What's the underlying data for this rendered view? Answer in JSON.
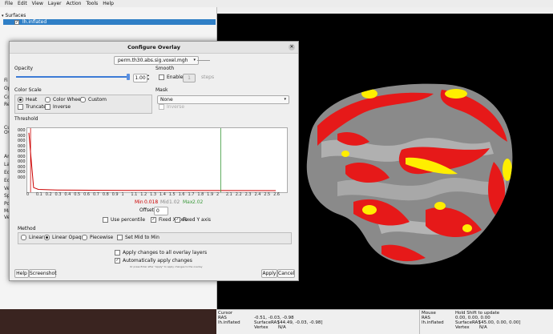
{
  "menu": [
    "File",
    "Edit",
    "View",
    "Layer",
    "Action",
    "Tools",
    "Help"
  ],
  "layers": {
    "header": "Surfaces",
    "item": "lh.inflated"
  },
  "side_labels": [
    "Fi",
    "Op",
    "Co",
    "Re",
    "Cu",
    "Ov",
    "An",
    "La",
    "Ed",
    "Ed",
    "Ve",
    "Sp",
    "Po",
    "Ma",
    "Ve"
  ],
  "dialog": {
    "title": "Configure Overlay",
    "overlay_file": "perm.th30.abs.sig.voxel.mgh",
    "opacity_label": "Opacity",
    "opacity_value": "1.00",
    "opacity_fraction": 1.0,
    "smooth_label": "Smooth",
    "smooth_enable": "Enable",
    "smooth_steps": "1",
    "smooth_steps_unit": "steps",
    "color_scale_label": "Color Scale",
    "color_options": [
      "Heat",
      "Color Wheel",
      "Custom"
    ],
    "color_selected": "Heat",
    "truncate": "Truncate",
    "inverse": "Inverse",
    "mask_label": "Mask",
    "mask_value": "None",
    "mask_inverse": "Inverse",
    "threshold_label": "Threshold",
    "min_label": "Min",
    "min_value": "0.018",
    "mid_label": "Mid",
    "mid_value": "1.02",
    "max_label": "Max",
    "max_value": "2.02",
    "offset_label": "Offset",
    "offset_value": "0",
    "use_percentile": "Use percentile",
    "fixed_x": "Fixed X axis",
    "fixed_y": "Fixed Y axis",
    "method_label": "Method",
    "methods": [
      "Linear",
      "Linear Opaque",
      "Piecewise"
    ],
    "method_selected": "Linear Opaque",
    "set_mid": "Set Mid to Min",
    "apply_all": "Apply changes to all overlay layers",
    "auto_apply": "Automatically apply changes",
    "hint": "Or press Enter after \"Apply\" to apply changes to the overlay",
    "help_btn": "Help",
    "screenshot_btn": "Screenshot",
    "apply_btn": "Apply",
    "cancel_btn": "Cancel"
  },
  "info": {
    "cursor_label": "Cursor",
    "cursor_ras_label": "RAS",
    "cursor_ras": "-0.51, -0.03, -0.98",
    "cursor_layer": "lh.inflated",
    "cursor_surfras_label": "SurfaceRAS",
    "cursor_surfras": "[44.49, -0.03, -0.98]",
    "cursor_vertex_label": "Vertex",
    "cursor_vertex": "N/A",
    "mouse_label": "Mouse",
    "mouse_hint": "Hold Shift to update",
    "mouse_ras_label": "RAS",
    "mouse_ras": "0.00, 0.00, 0.00",
    "mouse_layer": "lh.inflated",
    "mouse_surfras_label": "SurfaceRAS",
    "mouse_surfras": "[45.00, 0.00, 0.00]",
    "mouse_vertex_label": "Vertex",
    "mouse_vertex": "N/A"
  },
  "chart_data": {
    "type": "area",
    "y_tick_labels": [
      "000",
      "000",
      "000",
      "000",
      "000",
      "000",
      "000",
      "000",
      "000",
      "000"
    ],
    "x_tick_labels": [
      "0",
      "0.1",
      "0.2",
      "0.3",
      "0.4",
      "0.5",
      "0.6",
      "0.7",
      "0.8",
      "0.9",
      "1",
      "1.1",
      "1.2",
      "1.3",
      "1.4",
      "1.5",
      "1.6",
      "1.7",
      "1.8",
      "1.9",
      "2",
      "2.1",
      "2.2",
      "2.3",
      "2.4",
      "2.5",
      "2.6"
    ],
    "xlim": [
      0,
      2.7
    ],
    "x": [
      0,
      0.05,
      0.1,
      0.2,
      0.3,
      0.5,
      0.8,
      1.0,
      1.5,
      2.0,
      2.6
    ],
    "values": [
      0.95,
      0.05,
      0.02,
      0.015,
      0.01,
      0.008,
      0.005,
      0.003,
      0.002,
      0.001,
      0.0
    ],
    "markers": [
      {
        "label": "min",
        "x": 0.018
      },
      {
        "label": "max",
        "x": 2.02
      }
    ],
    "colors": {
      "curve": "#cc0000",
      "min_line": "#cc0000",
      "max_line": "#3c9a3c"
    }
  },
  "colors": {
    "selection": "#2f7fc6",
    "surface_gray": "#7d7d7d",
    "overlay_red": "#e61919",
    "overlay_yellow": "#ffee00"
  }
}
